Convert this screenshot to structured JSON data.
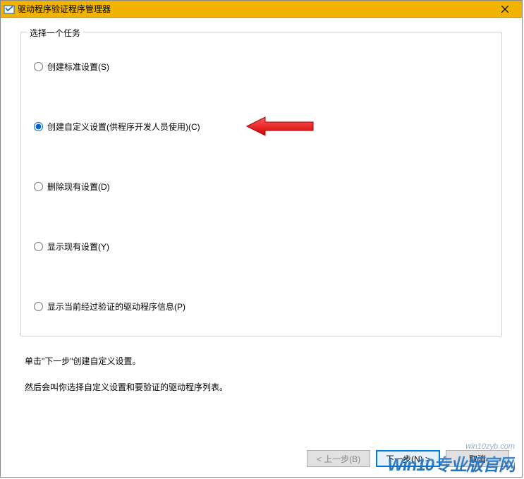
{
  "window": {
    "title": "驱动程序验证程序管理器"
  },
  "fieldset": {
    "legend": "选择一个任务"
  },
  "options": [
    {
      "label": "创建标准设置(S)",
      "checked": false
    },
    {
      "label": "创建自定义设置(供程序开发人员使用)(C)",
      "checked": true
    },
    {
      "label": "删除现有设置(D)",
      "checked": false
    },
    {
      "label": "显示现有设置(Y)",
      "checked": false
    },
    {
      "label": "显示当前经过验证的驱动程序信息(P)",
      "checked": false
    }
  ],
  "instructions": {
    "line1": "单击\"下一步\"创建自定义设置。",
    "line2": "然后会叫你选择自定义设置和要验证的驱动程序列表。"
  },
  "buttons": {
    "back": "< 上一步(B)",
    "next": "下一步(N) >",
    "cancel": "取消"
  },
  "watermark": {
    "url": "win10zyb.com",
    "text": "Win10专业版官网"
  }
}
